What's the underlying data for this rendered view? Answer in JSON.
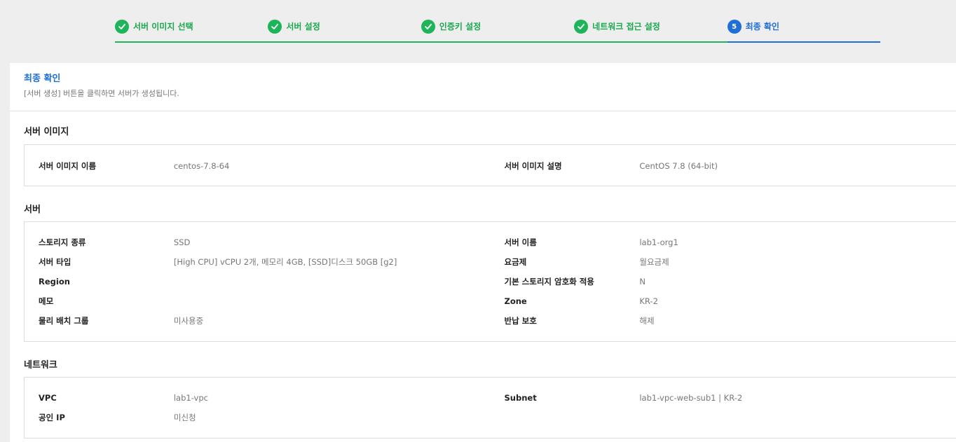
{
  "stepper": {
    "steps": [
      {
        "label": "서버 이미지 선택",
        "state": "done"
      },
      {
        "label": "서버 설정",
        "state": "done"
      },
      {
        "label": "인증키 설정",
        "state": "done"
      },
      {
        "label": "네트워크 접근 설정",
        "state": "done"
      },
      {
        "label": "최종 확인",
        "state": "current",
        "number": "5"
      }
    ]
  },
  "header": {
    "title": "최종 확인",
    "description": "[서버 생성] 버튼을 클릭하면 서버가 생성됩니다."
  },
  "sections": {
    "image": {
      "title": "서버 이미지",
      "rows": [
        {
          "l_label": "서버 이미지 이름",
          "l_value": "centos-7.8-64",
          "r_label": "서버 이미지 설명",
          "r_value": "CentOS 7.8 (64-bit)"
        }
      ]
    },
    "server": {
      "title": "서버",
      "rows": [
        {
          "l_label": "스토리지 종류",
          "l_value": "SSD",
          "r_label": "서버 이름",
          "r_value": "lab1-org1"
        },
        {
          "l_label": "서버 타입",
          "l_value": "[High CPU] vCPU 2개, 메모리 4GB, [SSD]디스크 50GB [g2]",
          "r_label": "요금제",
          "r_value": "월요금제"
        },
        {
          "l_label": "Region",
          "l_value": "",
          "r_label": "기본 스토리지 암호화 적용",
          "r_value": "N"
        },
        {
          "l_label": "메모",
          "l_value": "",
          "r_label": "Zone",
          "r_value": "KR-2"
        },
        {
          "l_label": "물리 배치 그룹",
          "l_value": "미사용중",
          "r_label": "반납 보호",
          "r_value": "해제"
        }
      ]
    },
    "network": {
      "title": "네트워크",
      "rows": [
        {
          "l_label": "VPC",
          "l_value": "lab1-vpc",
          "r_label": "Subnet",
          "r_value": "lab1-vpc-web-sub1 | KR-2"
        },
        {
          "l_label": "공인 IP",
          "l_value": "미신청",
          "r_label": "",
          "r_value": ""
        }
      ]
    }
  },
  "colors": {
    "done": "#1fb35a",
    "current": "#1f6fd6"
  }
}
